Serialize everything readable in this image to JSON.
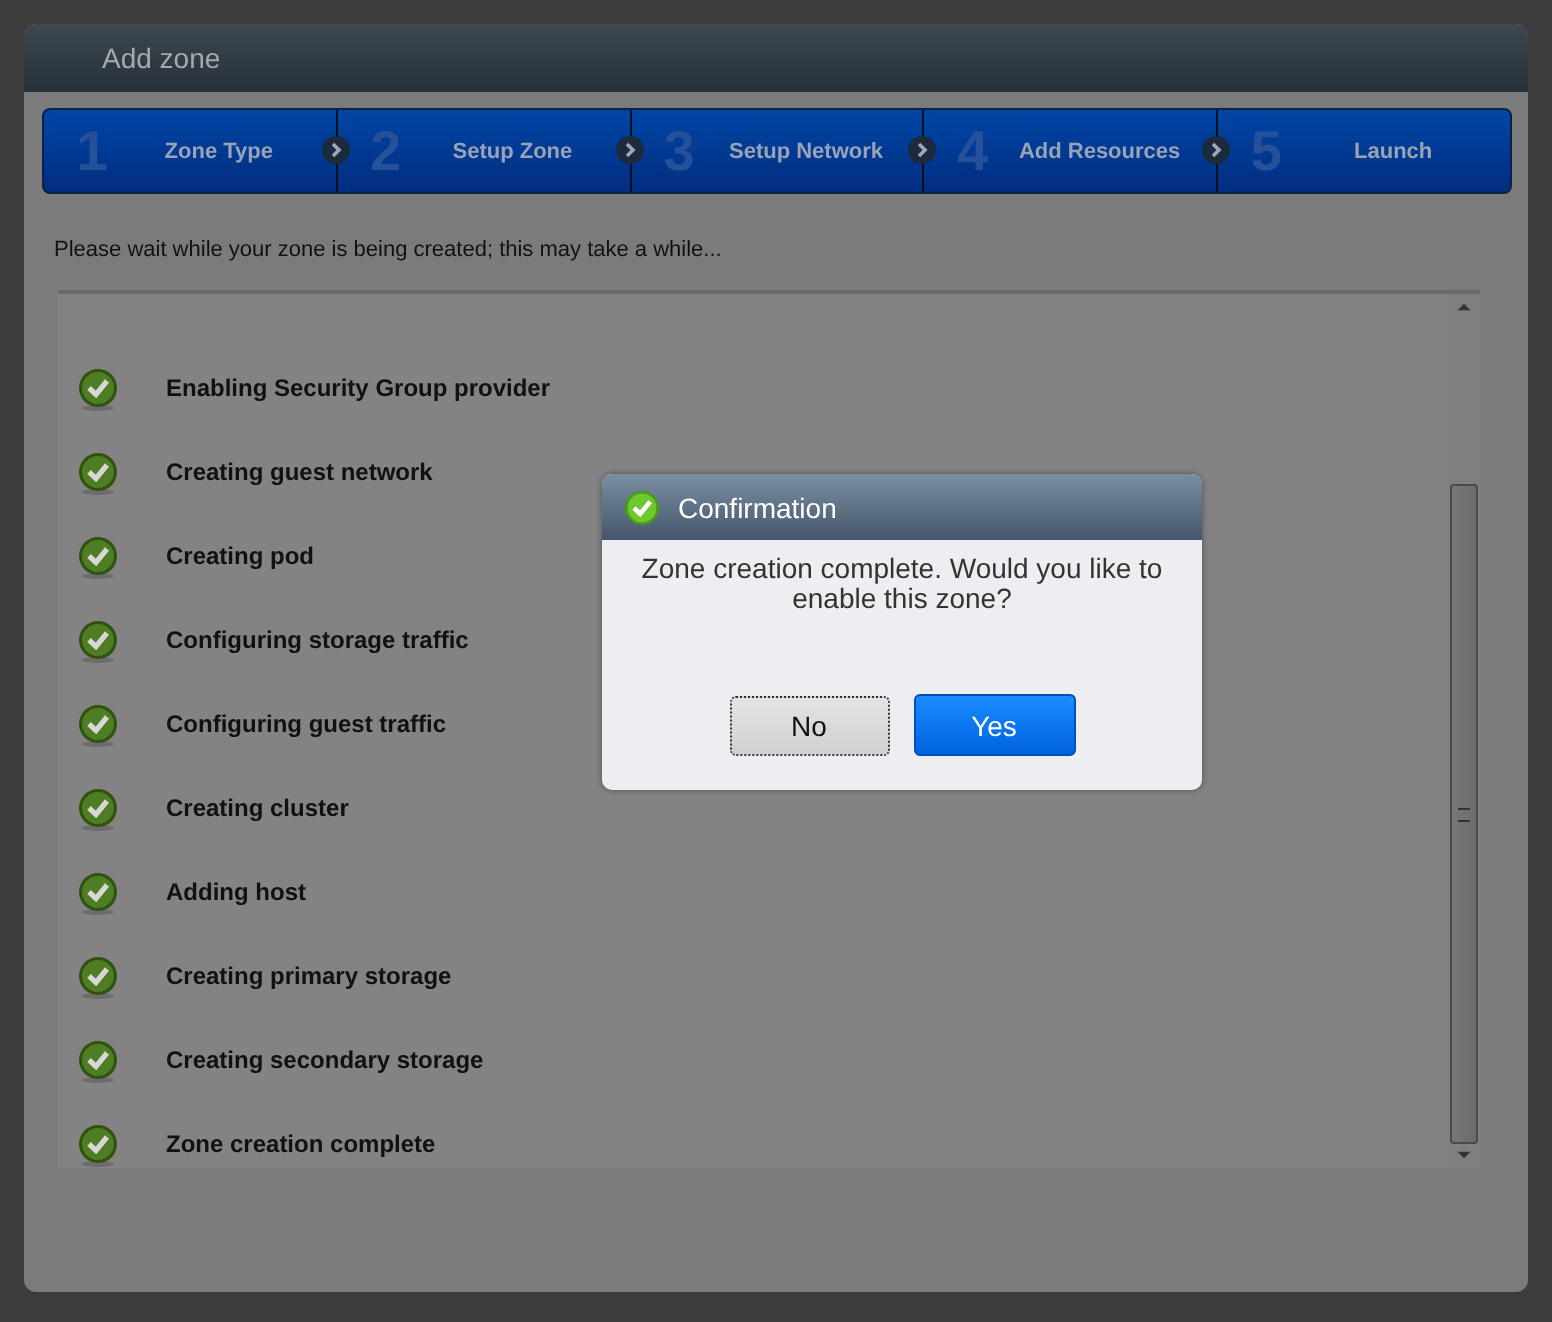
{
  "window": {
    "title": "Add zone"
  },
  "steps": [
    {
      "number": "1",
      "label": "Zone Type"
    },
    {
      "number": "2",
      "label": "Setup Zone"
    },
    {
      "number": "3",
      "label": "Setup Network"
    },
    {
      "number": "4",
      "label": "Add Resources"
    },
    {
      "number": "5",
      "label": "Launch"
    }
  ],
  "message": "Please wait while your zone is being created; this may take a while...",
  "tasks": [
    {
      "label": "Enabling Security Group provider",
      "done": true
    },
    {
      "label": "Creating guest network",
      "done": true
    },
    {
      "label": "Creating pod",
      "done": true
    },
    {
      "label": "Configuring storage traffic",
      "done": true
    },
    {
      "label": "Configuring guest traffic",
      "done": true
    },
    {
      "label": "Creating cluster",
      "done": true
    },
    {
      "label": "Adding host",
      "done": true
    },
    {
      "label": "Creating primary storage",
      "done": true
    },
    {
      "label": "Creating secondary storage",
      "done": true
    },
    {
      "label": "Zone creation complete",
      "done": true
    }
  ],
  "dialog": {
    "title": "Confirmation",
    "message": "Zone creation complete. Would you like to enable this zone?",
    "buttons": [
      {
        "label": "No",
        "kind": "secondary"
      },
      {
        "label": "Yes",
        "kind": "primary"
      }
    ]
  }
}
